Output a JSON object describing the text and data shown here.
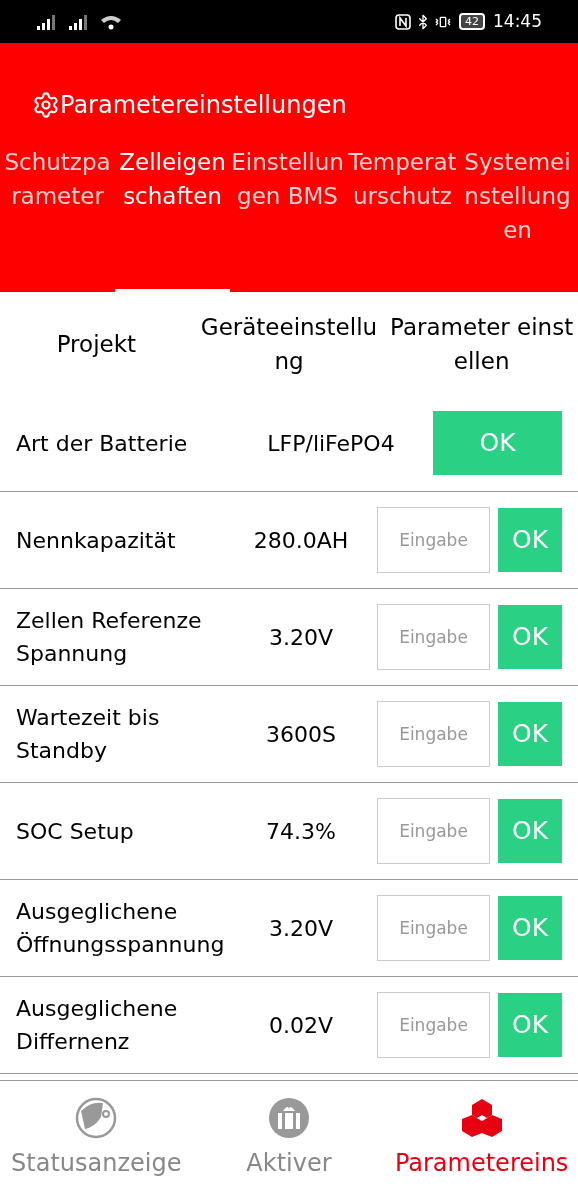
{
  "status_bar": {
    "battery": "42",
    "time": "14:45"
  },
  "header": {
    "title": "Parametereinstellungen"
  },
  "tabs": [
    {
      "label": "Schutzparameter",
      "selected": false
    },
    {
      "label": "Zelleigenschaften",
      "selected": true
    },
    {
      "label": "Einstellungen BMS",
      "selected": false
    },
    {
      "label": "Temperaturschutz",
      "selected": false
    },
    {
      "label": "Systemeinstellungen",
      "selected": false
    }
  ],
  "table": {
    "columns": [
      "Projekt",
      "Geräteeinstellung",
      "Parameter einstellen"
    ],
    "rows": [
      {
        "kind": "fixed",
        "name": "Art der Batterie",
        "value": "LFP/liFePO4",
        "button": "OK"
      },
      {
        "kind": "input",
        "name": "Nennkapazität",
        "value": "280.0AH",
        "placeholder": "Eingabe",
        "button": "OK"
      },
      {
        "kind": "input",
        "name": "Zellen Referenze Spannung",
        "value": "3.20V",
        "placeholder": "Eingabe",
        "button": "OK"
      },
      {
        "kind": "input",
        "name": "Wartezeit bis Standby",
        "value": "3600S",
        "placeholder": "Eingabe",
        "button": "OK"
      },
      {
        "kind": "input",
        "name": "SOC Setup",
        "value": "74.3%",
        "placeholder": "Eingabe",
        "button": "OK"
      },
      {
        "kind": "input",
        "name": "Ausgeglichene Öffnungsspannung",
        "value": "3.20V",
        "placeholder": "Eingabe",
        "button": "OK"
      },
      {
        "kind": "input",
        "name": "Ausgeglichene Differnenz",
        "value": "0.02V",
        "placeholder": "Eingabe",
        "button": "OK"
      }
    ]
  },
  "bottom_nav": [
    {
      "label": "Statusanzeige",
      "selected": false
    },
    {
      "label": "Aktiver",
      "selected": false
    },
    {
      "label": "Parametereins",
      "selected": true
    }
  ]
}
